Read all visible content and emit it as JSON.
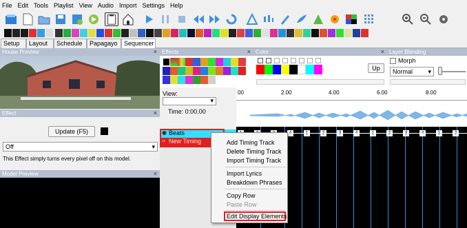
{
  "menu": [
    "File",
    "Edit",
    "Tools",
    "Playlist",
    "View",
    "Audio",
    "Import",
    "Settings",
    "Help"
  ],
  "tabs": [
    {
      "label": "Setup",
      "selected": false
    },
    {
      "label": "Layout",
      "selected": false
    },
    {
      "label": "Schedule",
      "selected": false
    },
    {
      "label": "Papagayo",
      "selected": false
    },
    {
      "label": "Sequencer",
      "selected": true
    }
  ],
  "panels": {
    "house_preview": "House Preview",
    "effects": "Effects",
    "color": "Color",
    "layer_blending": "Layer Blending",
    "effect": "Effect",
    "model_preview": "Model Preview"
  },
  "effect_panel": {
    "update_button": "Update (F5)",
    "effect_select": "Off",
    "description": "This Effect simply turns every pixel off on this model."
  },
  "color_panel": {
    "update_button": "Up"
  },
  "layer_blending": {
    "morph_label": "Morph",
    "blend_mode": "Normal"
  },
  "sequencer": {
    "view_label": "View:",
    "time": "Time: 0:00.00",
    "rows": [
      "Beats",
      "New Timing"
    ],
    "timeline_ticks": [
      "00",
      "2.00",
      "4.00",
      "6.00",
      "8.00"
    ]
  },
  "context_menu": [
    {
      "label": "Add Timing Track",
      "enabled": true
    },
    {
      "label": "Delete Timing Track",
      "enabled": true
    },
    {
      "label": "Import Timing Track",
      "enabled": true
    },
    {
      "label": "Import Lyrics",
      "enabled": true
    },
    {
      "label": "Breakdown Phrases",
      "enabled": true
    },
    {
      "label": "Copy Row",
      "enabled": true
    },
    {
      "label": "Paste Row",
      "enabled": false
    },
    {
      "label": "Edit Display Elements",
      "enabled": true,
      "highlighted": true
    }
  ],
  "beat_markers": [
    "1",
    "2",
    "3",
    "4",
    "1",
    "2",
    "3",
    "4",
    "1",
    "2",
    "3",
    "4",
    "1",
    "2"
  ],
  "colors": {
    "highlight_red": "#e02020",
    "beats_row": "#33e0ff",
    "grid_line": "#3b8bd6",
    "panel_title": "#b5bfd0"
  }
}
